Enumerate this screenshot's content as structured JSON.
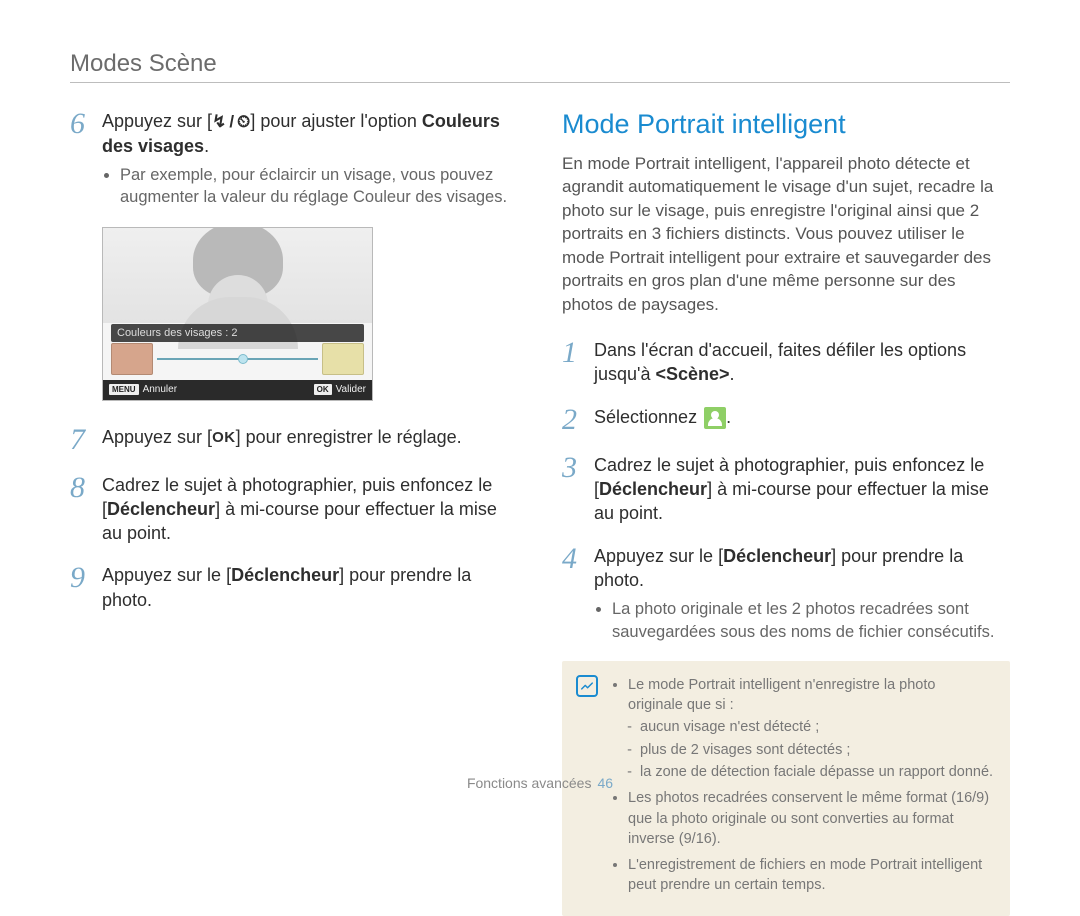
{
  "header": {
    "title": "Modes Scène"
  },
  "left": {
    "step6": {
      "num": "6",
      "pre": "Appuyez sur [",
      "icon_flash": "↯",
      "slash": "/",
      "icon_timer": "⏲",
      "mid": "] pour ajuster l'option ",
      "bold": "Couleurs des visages",
      "post": "."
    },
    "step6_sub": {
      "text": "Par exemple, pour éclaircir un visage, vous pouvez augmenter la valeur du réglage Couleur des visages."
    },
    "camera": {
      "label": "Couleurs des visages : 2",
      "menu_badge": "MENU",
      "cancel": "Annuler",
      "ok_badge": "OK",
      "validate": "Valider"
    },
    "step7": {
      "num": "7",
      "pre": "Appuyez sur [",
      "ok": "OK",
      "post": "] pour enregistrer le réglage."
    },
    "step8": {
      "num": "8",
      "line1": "Cadrez le sujet à photographier, puis enfoncez le",
      "line2_pre": "[",
      "line2_bold": "Déclencheur",
      "line2_post": "] à mi-course pour effectuer la mise au point."
    },
    "step9": {
      "num": "9",
      "pre": "Appuyez sur le [",
      "bold": "Déclencheur",
      "post": "] pour prendre la photo."
    }
  },
  "right": {
    "heading": "Mode Portrait intelligent",
    "para": "En mode Portrait intelligent, l'appareil photo détecte et agrandit automatiquement le visage d'un sujet, recadre la photo sur le visage, puis enregistre l'original ainsi que 2 portraits en 3 fichiers distincts. Vous pouvez utiliser le mode Portrait intelligent pour extraire et sauvegarder des portraits en gros plan d'une même personne sur des photos de paysages.",
    "step1": {
      "num": "1",
      "line": "Dans l'écran d'accueil, faites défiler les options jusqu'à ",
      "bold": "<Scène>",
      "post": "."
    },
    "step2": {
      "num": "2",
      "pre": "Sélectionnez ",
      "icon_name": "portrait-intelligent-icon",
      "post": "."
    },
    "step3": {
      "num": "3",
      "line1": "Cadrez le sujet à photographier, puis enfoncez le",
      "line2_pre": "[",
      "line2_bold": "Déclencheur",
      "line2_post": "] à mi-course pour effectuer la mise au point."
    },
    "step4": {
      "num": "4",
      "pre": "Appuyez sur le [",
      "bold": "Déclencheur",
      "post": "] pour prendre la photo.",
      "sub": "La photo originale et les 2 photos recadrées sont sauvegardées sous des noms de fichier consécutifs."
    },
    "note": {
      "b1": "Le mode Portrait intelligent n'enregistre la photo originale que si :",
      "b1a": "aucun visage n'est détecté ;",
      "b1b": "plus de 2 visages sont détectés ;",
      "b1c": "la zone de détection faciale dépasse un rapport donné.",
      "b2": "Les photos recadrées conservent le même format (16/9) que la photo originale ou sont converties au format inverse (9/16).",
      "b3": "L'enregistrement de fichiers en mode Portrait intelligent peut prendre un certain temps."
    }
  },
  "footer": {
    "label": "Fonctions avancées",
    "page": "46"
  }
}
